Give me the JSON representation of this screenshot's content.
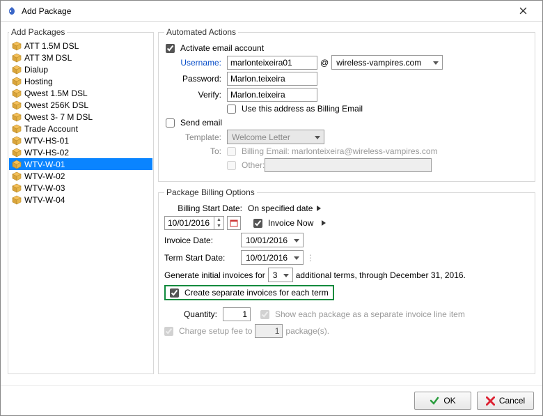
{
  "window": {
    "title": "Add Package"
  },
  "left": {
    "legend": "Add Packages",
    "items": [
      "ATT 1.5M DSL",
      "ATT 3M DSL",
      "Dialup",
      "Hosting",
      "Qwest 1.5M DSL",
      "Qwest 256K DSL",
      "Qwest 3- 7 M DSL",
      "Trade Account",
      "WTV-HS-01",
      "WTV-HS-02",
      "WTV-W-01",
      "WTV-W-02",
      "WTV-W-03",
      "WTV-W-04"
    ],
    "selected_index": 10
  },
  "automated": {
    "legend": "Automated Actions",
    "activate_label": "Activate email account",
    "activate_checked": true,
    "username_label": "Username:",
    "username_value": "marlonteixeira01",
    "at": "@",
    "domain_value": "wireless-vampires.com",
    "password_label": "Password:",
    "password_value": "Marlon.teixeira",
    "verify_label": "Verify:",
    "verify_value": "Marlon.teixeira",
    "billing_email_label": "Use this address as Billing Email",
    "billing_email_checked": false,
    "send_email_label": "Send email",
    "send_email_checked": false,
    "template_label": "Template:",
    "template_value": "Welcome Letter",
    "to_label": "To:",
    "to_billing_label": "Billing Email:  marlonteixeira@wireless-vampires.com",
    "to_other_label": "Other:"
  },
  "billing": {
    "legend": "Package Billing Options",
    "start_date_label": "Billing Start Date:",
    "start_mode": "On specified date",
    "start_value": "10/01/2016",
    "invoice_now_label": "Invoice Now",
    "invoice_now_checked": true,
    "invoice_date_label": "Invoice Date:",
    "invoice_date_value": "10/01/2016",
    "term_start_label": "Term Start Date:",
    "term_start_value": "10/01/2016",
    "generate_prefix": "Generate initial invoices for",
    "generate_terms": "3",
    "generate_suffix": "additional terms, through  December 31, 2016.",
    "separate_label": "Create separate invoices for each term",
    "separate_checked": true,
    "quantity_label": "Quantity:",
    "quantity_value": "1",
    "show_each_label": "Show each package as a separate invoice line item",
    "show_each_checked": true,
    "charge_label_pre": "Charge setup fee to",
    "charge_value": "1",
    "charge_label_post": "package(s).",
    "charge_checked": true
  },
  "buttons": {
    "ok": "OK",
    "cancel": "Cancel"
  }
}
